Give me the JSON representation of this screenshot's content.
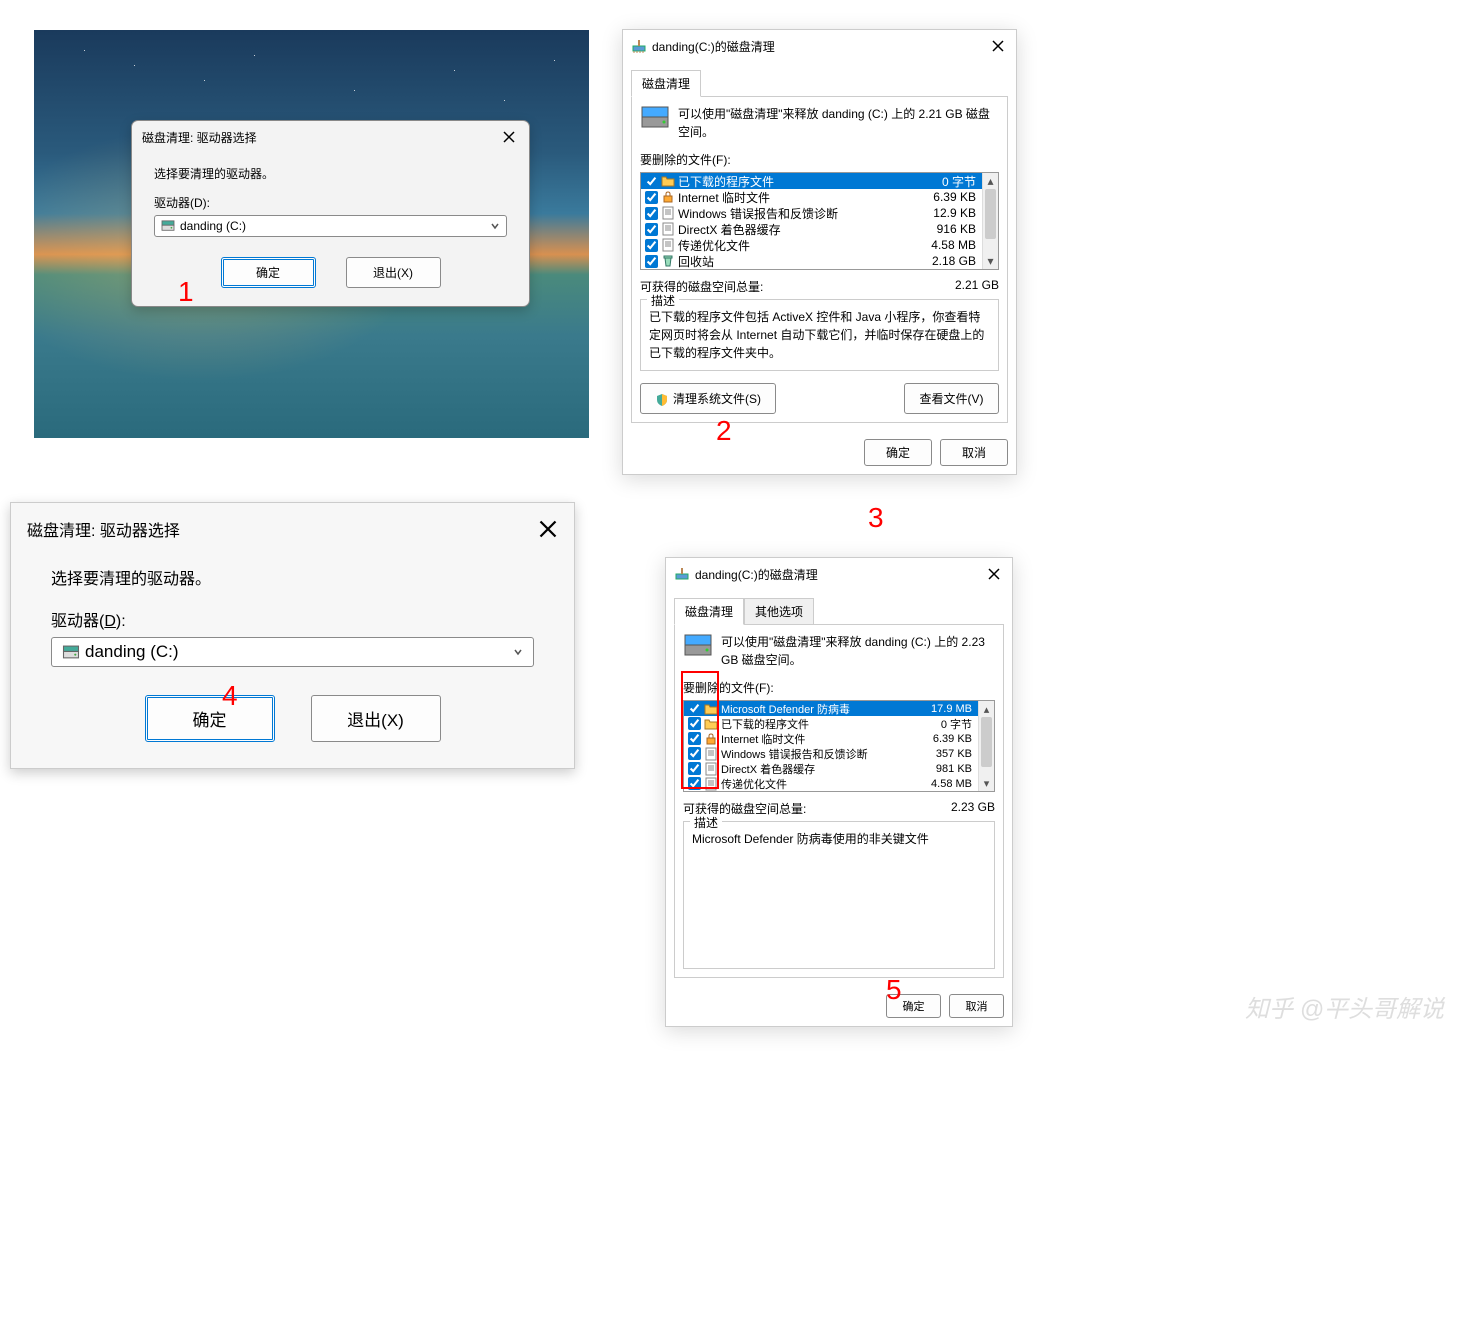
{
  "annotations": {
    "one": "1",
    "two": "2",
    "three": "3",
    "four": "4",
    "five": "5"
  },
  "dlg1": {
    "title": "磁盘清理: 驱动器选择",
    "prompt": "选择要清理的驱动器。",
    "drive_label": "驱动器(D):",
    "drive_value": "danding (C:)",
    "ok": "确定",
    "exit": "退出(X)"
  },
  "dlg4": {
    "title": "磁盘清理: 驱动器选择",
    "prompt": "选择要清理的驱动器。",
    "drive_label_pre": "驱动器(",
    "drive_label_u": "D",
    "drive_label_post": "):",
    "drive_value": "danding (C:)",
    "ok": "确定",
    "exit": "退出(X)"
  },
  "win2": {
    "title": "danding(C:)的磁盘清理",
    "tab": "磁盘清理",
    "info": "可以使用\"磁盘清理\"来释放 danding (C:) 上的 2.21 GB 磁盘空间。",
    "files_label": "要删除的文件(F):",
    "files": [
      {
        "name": "已下载的程序文件",
        "size": "0 字节",
        "checked": true,
        "selected": true,
        "icon": "folder"
      },
      {
        "name": "Internet 临时文件",
        "size": "6.39 KB",
        "checked": true,
        "selected": false,
        "icon": "lock"
      },
      {
        "name": "Windows 错误报告和反馈诊断",
        "size": "12.9 KB",
        "checked": true,
        "selected": false,
        "icon": "file"
      },
      {
        "name": "DirectX 着色器缓存",
        "size": "916 KB",
        "checked": true,
        "selected": false,
        "icon": "file"
      },
      {
        "name": "传递优化文件",
        "size": "4.58 MB",
        "checked": true,
        "selected": false,
        "icon": "file"
      },
      {
        "name": "回收站",
        "size": "2.18 GB",
        "checked": true,
        "selected": false,
        "icon": "recycle"
      }
    ],
    "total_label": "可获得的磁盘空间总量:",
    "total_value": "2.21 GB",
    "desc_label": "描述",
    "desc_text": "已下载的程序文件包括 ActiveX 控件和 Java 小程序，你查看特定网页时将会从 Internet 自动下载它们，并临时保存在硬盘上的已下载的程序文件夹中。",
    "clean_sys": "清理系统文件(S)",
    "view_files": "查看文件(V)",
    "ok": "确定",
    "cancel": "取消"
  },
  "win5": {
    "title": "danding(C:)的磁盘清理",
    "tab1": "磁盘清理",
    "tab2": "其他选项",
    "info": "可以使用\"磁盘清理\"来释放 danding (C:) 上的 2.23 GB 磁盘空间。",
    "files_label": "要删除的文件(F):",
    "files": [
      {
        "name": "Microsoft Defender 防病毒",
        "size": "17.9 MB",
        "checked": true,
        "selected": true,
        "icon": "folder"
      },
      {
        "name": "已下载的程序文件",
        "size": "0 字节",
        "checked": true,
        "selected": false,
        "icon": "folder-y"
      },
      {
        "name": "Internet 临时文件",
        "size": "6.39 KB",
        "checked": true,
        "selected": false,
        "icon": "lock"
      },
      {
        "name": "Windows 错误报告和反馈诊断",
        "size": "357 KB",
        "checked": true,
        "selected": false,
        "icon": "file"
      },
      {
        "name": "DirectX 着色器缓存",
        "size": "981 KB",
        "checked": true,
        "selected": false,
        "icon": "file"
      },
      {
        "name": "传递优化文件",
        "size": "4.58 MB",
        "checked": true,
        "selected": false,
        "icon": "file"
      }
    ],
    "total_label": "可获得的磁盘空间总量:",
    "total_value": "2.23 GB",
    "desc_label": "描述",
    "desc_text": "Microsoft Defender 防病毒使用的非关键文件",
    "ok": "确定",
    "cancel": "取消"
  },
  "watermark": "知乎 @平头哥解说"
}
